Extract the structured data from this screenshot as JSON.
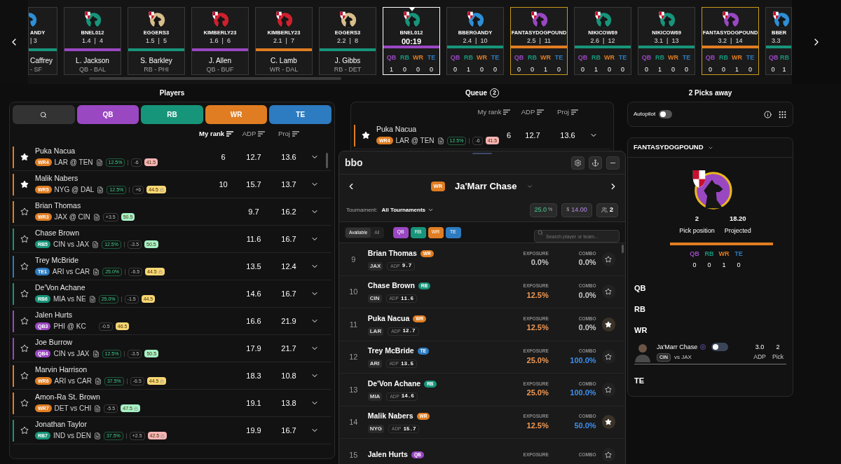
{
  "draft_board": {
    "picks": [
      {
        "kind": "pick",
        "team": "ANDY",
        "info": "| 3",
        "color": "#17957a",
        "avatar": {
          "color": "#2d8fd6"
        },
        "player": "Caffrey",
        "detail": "- SF",
        "selected": false,
        "mine": false
      },
      {
        "kind": "pick",
        "team": "BNEL012",
        "info": "1.4  |  4",
        "color": "#9a47c2",
        "avatar": {
          "color": "#16957c"
        },
        "player": "L. Jackson",
        "detail": "QB - BAL",
        "selected": false,
        "mine": false
      },
      {
        "kind": "pick",
        "team": "EGGERS3",
        "info": "1.5  |  5",
        "color": "#17957a",
        "avatar": {
          "color": "#d9be8c"
        },
        "player": "S. Barkley",
        "detail": "RB - PHI",
        "selected": false,
        "mine": false
      },
      {
        "kind": "pick",
        "team": "KIMBERLY23",
        "info": "1.6  |  6",
        "color": "#9a47c2",
        "avatar": {
          "color": "#d0202e"
        },
        "player": "J. Allen",
        "detail": "QB - BUF",
        "selected": false,
        "mine": false
      },
      {
        "kind": "pick",
        "team": "KIMBERLY23",
        "info": "2.1  |  7",
        "color": "#e07d22",
        "avatar": {
          "color": "#d0202e"
        },
        "player": "C. Lamb",
        "detail": "WR - DAL",
        "selected": false,
        "mine": false
      },
      {
        "kind": "pick",
        "team": "EGGERS3",
        "info": "2.2  |  8",
        "color": "#17957a",
        "avatar": {
          "color": "#d9be8c"
        },
        "player": "J. Gibbs",
        "detail": "RB - DET",
        "selected": false,
        "mine": false
      },
      {
        "kind": "upcoming",
        "team": "BNEL012",
        "timer": "00:19",
        "color": "#9a47c2",
        "avatar": {
          "color": "#16957c"
        },
        "selected": true,
        "mine": false,
        "counts": [
          {
            "label": "QB",
            "value": "1",
            "color": "#9a47c2"
          },
          {
            "label": "RB",
            "value": "0",
            "color": "#17957a"
          },
          {
            "label": "WR",
            "value": "0",
            "color": "#e07d22"
          },
          {
            "label": "TE",
            "value": "0",
            "color": "#2d7bc0"
          }
        ]
      },
      {
        "kind": "upcoming",
        "team": "BBERGANDY",
        "info": "2.4  |  10",
        "color": "#17957a",
        "avatar": {
          "color": "#2d8fd6"
        },
        "selected": false,
        "mine": false,
        "counts": [
          {
            "label": "QB",
            "value": "0",
            "color": "#9a47c2"
          },
          {
            "label": "RB",
            "value": "1",
            "color": "#17957a"
          },
          {
            "label": "WR",
            "value": "0",
            "color": "#e07d22"
          },
          {
            "label": "TE",
            "value": "0",
            "color": "#2d7bc0"
          }
        ]
      },
      {
        "kind": "upcoming",
        "team": "FANTASYDOGPOUND",
        "info": "2.5  |  11",
        "color": "#e07d22",
        "avatar": {
          "color": "#9a47c2"
        },
        "selected": false,
        "mine": true,
        "counts": [
          {
            "label": "QB",
            "value": "0",
            "color": "#9a47c2"
          },
          {
            "label": "RB",
            "value": "0",
            "color": "#17957a"
          },
          {
            "label": "WR",
            "value": "1",
            "color": "#e07d22"
          },
          {
            "label": "TE",
            "value": "0",
            "color": "#2d7bc0"
          }
        ]
      },
      {
        "kind": "upcoming",
        "team": "NIKICOW69",
        "info": "2.6  |  12",
        "color": "#17957a",
        "avatar": {
          "color": "#16957c"
        },
        "selected": false,
        "mine": false,
        "counts": [
          {
            "label": "QB",
            "value": "0",
            "color": "#9a47c2"
          },
          {
            "label": "RB",
            "value": "1",
            "color": "#17957a"
          },
          {
            "label": "WR",
            "value": "0",
            "color": "#e07d22"
          },
          {
            "label": "TE",
            "value": "0",
            "color": "#2d7bc0"
          }
        ]
      },
      {
        "kind": "upcoming",
        "team": "NIKICOW69",
        "info": "3.1  |  13",
        "color": "#17957a",
        "avatar": {
          "color": "#16957c"
        },
        "selected": false,
        "mine": false,
        "counts": [
          {
            "label": "QB",
            "value": "0",
            "color": "#9a47c2"
          },
          {
            "label": "RB",
            "value": "1",
            "color": "#17957a"
          },
          {
            "label": "WR",
            "value": "0",
            "color": "#e07d22"
          },
          {
            "label": "TE",
            "value": "0",
            "color": "#2d7bc0"
          }
        ]
      },
      {
        "kind": "upcoming",
        "team": "FANTASYDOGPOUND",
        "info": "3.2  |  14",
        "color": "#e07d22",
        "avatar": {
          "color": "#9a47c2"
        },
        "selected": false,
        "mine": true,
        "counts": [
          {
            "label": "QB",
            "value": "0",
            "color": "#9a47c2"
          },
          {
            "label": "RB",
            "value": "0",
            "color": "#17957a"
          },
          {
            "label": "WR",
            "value": "1",
            "color": "#e07d22"
          },
          {
            "label": "TE",
            "value": "0",
            "color": "#2d7bc0"
          }
        ]
      },
      {
        "kind": "upcoming",
        "team": "BBER",
        "info": "3.3",
        "color": "#17957a",
        "avatar": {
          "color": "#2d8fd6"
        },
        "selected": false,
        "mine": false,
        "counts": [
          {
            "label": "QB",
            "value": "0",
            "color": "#9a47c2"
          },
          {
            "label": "RB",
            "value": "1",
            "color": "#17957a"
          }
        ]
      }
    ]
  },
  "players": {
    "title": "Players",
    "filters": [
      {
        "kind": "search",
        "color": "#333333"
      },
      {
        "kind": "position",
        "label": "QB",
        "color": "#9a47c2"
      },
      {
        "kind": "position",
        "label": "RB",
        "color": "#17957a"
      },
      {
        "kind": "position",
        "label": "WR",
        "color": "#e07d22"
      },
      {
        "kind": "position",
        "label": "TE",
        "color": "#2d7bc0"
      }
    ],
    "columns": [
      {
        "label": "My rank",
        "active": true
      },
      {
        "label": "ADP",
        "active": false
      },
      {
        "label": "Proj",
        "active": false
      }
    ],
    "rows": [
      {
        "name": "Puka Nacua",
        "pos": "WR4",
        "color": "#e07d22",
        "matchup": "LAR @ TEN",
        "note": true,
        "exposure": "12.5%",
        "spread": "-6",
        "total": {
          "text": "41.5",
          "color": "#f6b4b4",
          "locked": false
        },
        "starred": true,
        "rank": "6",
        "adp": "12.7",
        "proj": "13.6"
      },
      {
        "name": "Malik Nabers",
        "pos": "WR5",
        "color": "#e07d22",
        "matchup": "NYG @ DAL",
        "note": true,
        "exposure": "12.5%",
        "spread": "+6",
        "total": {
          "text": "44.5",
          "color": "#f7d774",
          "locked": true
        },
        "starred": true,
        "rank": "10",
        "adp": "15.7",
        "proj": "13.7"
      },
      {
        "name": "Brian Thomas",
        "pos": "WR3",
        "color": "#e07d22",
        "matchup": "JAX @ CIN",
        "note": true,
        "spread": "+3.5",
        "total": {
          "text": "50.5",
          "color": "#a6f0c6",
          "locked": false
        },
        "starred": false,
        "adp": "9.7",
        "proj": "16.2"
      },
      {
        "name": "Chase Brown",
        "pos": "RB5",
        "color": "#17957a",
        "matchup": "CIN vs JAX",
        "note": true,
        "exposure": "12.5%",
        "spread": "-3.5",
        "total": {
          "text": "50.5",
          "color": "#a6f0c6",
          "locked": false
        },
        "starred": false,
        "adp": "11.6",
        "proj": "16.7"
      },
      {
        "name": "Trey McBride",
        "pos": "TE1",
        "color": "#2d7bc0",
        "matchup": "ARI vs CAR",
        "note": true,
        "exposure": "25.0%",
        "spread": "-6.5",
        "total": {
          "text": "44.5",
          "color": "#f7d774",
          "locked": true
        },
        "starred": false,
        "adp": "13.5",
        "proj": "12.4"
      },
      {
        "name": "De'Von Achane",
        "pos": "RB6",
        "color": "#17957a",
        "matchup": "MIA vs NE",
        "note": true,
        "exposure": "25.0%",
        "spread": "-1.5",
        "total": {
          "text": "44.5",
          "color": "#f7d774",
          "locked": false
        },
        "starred": false,
        "adp": "14.6",
        "proj": "16.7"
      },
      {
        "name": "Jalen Hurts",
        "pos": "QB3",
        "color": "#9a47c2",
        "matchup": "PHI @ KC",
        "note": false,
        "spread": "-0.5",
        "total": {
          "text": "46.5",
          "color": "#f7d774",
          "locked": false
        },
        "starred": false,
        "adp": "16.6",
        "proj": "21.9"
      },
      {
        "name": "Joe Burrow",
        "pos": "QB4",
        "color": "#9a47c2",
        "matchup": "CIN vs JAX",
        "note": true,
        "exposure": "12.5%",
        "spread": "-3.5",
        "total": {
          "text": "50.5",
          "color": "#a6f0c6",
          "locked": false
        },
        "starred": false,
        "adp": "17.9",
        "proj": "21.7"
      },
      {
        "name": "Marvin Harrison",
        "pos": "WR6",
        "color": "#e07d22",
        "matchup": "ARI vs CAR",
        "note": true,
        "exposure": "37.5%",
        "spread": "-6.5",
        "total": {
          "text": "44.5",
          "color": "#f7d774",
          "locked": true
        },
        "starred": false,
        "adp": "18.3",
        "proj": "10.8"
      },
      {
        "name": "Amon-Ra St. Brown",
        "pos": "WR7",
        "color": "#e07d22",
        "matchup": "DET vs CHI",
        "note": true,
        "spread": "-5.5",
        "total": {
          "text": "47.5",
          "color": "#a6f0c6",
          "locked": true
        },
        "starred": false,
        "adp": "19.1",
        "proj": "13.8"
      },
      {
        "name": "Jonathan Taylor",
        "pos": "RB7",
        "color": "#17957a",
        "matchup": "IND vs DEN",
        "note": true,
        "exposure": "37.5%",
        "spread": "+2.5",
        "total": {
          "text": "42.5",
          "color": "#f6b4b4",
          "locked": true
        },
        "starred": false,
        "adp": "19.9",
        "proj": "16.7"
      }
    ]
  },
  "queue": {
    "title": "Queue",
    "count": "2",
    "columns": [
      {
        "label": "My rank",
        "active": false
      },
      {
        "label": "ADP",
        "active": false
      },
      {
        "label": "Proj",
        "active": false
      }
    ],
    "rows": [
      {
        "name": "Puka Nacua",
        "pos": "WR4",
        "color": "#e07d22",
        "matchup": "LAR @ TEN",
        "note": true,
        "exposure": "12.5%",
        "spread": "-6",
        "total": {
          "text": "41.5",
          "color": "#f6b4b4",
          "locked": false
        },
        "starred": true,
        "rank": "6",
        "adp": "12.7",
        "proj": "13.6"
      }
    ]
  },
  "overlay": {
    "logo": "bbo",
    "player": {
      "pos": "WR",
      "color": "#e07d22",
      "name": "Ja'Marr Chase"
    },
    "tournament_label": "Tournament:",
    "tournament": "All Tournaments",
    "stats": [
      {
        "kind": "exposure",
        "value": "25.0",
        "unit": "%"
      },
      {
        "kind": "cost",
        "unit": "$",
        "value": "14.00"
      },
      {
        "kind": "entries",
        "value": "2"
      }
    ],
    "views": [
      {
        "label": "Available",
        "selected": true
      },
      {
        "label": "All",
        "selected": false
      }
    ],
    "chips": [
      {
        "label": "QB",
        "color": "#9a47c2"
      },
      {
        "label": "RB",
        "color": "#17957a"
      },
      {
        "label": "WR",
        "color": "#e07d22"
      },
      {
        "label": "TE",
        "color": "#2d7bc0"
      }
    ],
    "search": {
      "placeholder": "Search player or team..."
    },
    "rows": [
      {
        "rank": "9",
        "name": "Brian Thomas",
        "pos": "WR",
        "color": "#e07d22",
        "team": "JAX",
        "adp_label": "ADP",
        "adp": "9.7",
        "exposure_label": "EXPOSURE",
        "exposure": {
          "text": "0.0%",
          "color": "#c8c8c8"
        },
        "combo_label": "COMBO",
        "combo": {
          "text": "0.0%",
          "color": "#c8c8c8"
        },
        "starred": false
      },
      {
        "rank": "10",
        "name": "Chase Brown",
        "pos": "RB",
        "color": "#17957a",
        "team": "CIN",
        "adp_label": "ADP",
        "adp": "11.6",
        "exposure_label": "EXPOSURE",
        "exposure": {
          "text": "12.5%",
          "color": "#f29a55"
        },
        "combo_label": "COMBO",
        "combo": {
          "text": "0.0%",
          "color": "#c8c8c8"
        },
        "starred": false
      },
      {
        "rank": "11",
        "name": "Puka Nacua",
        "pos": "WR",
        "color": "#e07d22",
        "team": "LAR",
        "adp_label": "ADP",
        "adp": "12.7",
        "exposure_label": "EXPOSURE",
        "exposure": {
          "text": "12.5%",
          "color": "#f29a55"
        },
        "combo_label": "COMBO",
        "combo": {
          "text": "0.0%",
          "color": "#c8c8c8"
        },
        "starred": true
      },
      {
        "rank": "12",
        "name": "Trey McBride",
        "pos": "TE",
        "color": "#2d7bc0",
        "team": "ARI",
        "adp_label": "ADP",
        "adp": "13.5",
        "exposure_label": "EXPOSURE",
        "exposure": {
          "text": "25.0%",
          "color": "#f29a55"
        },
        "combo_label": "COMBO",
        "combo": {
          "text": "100.0%",
          "color": "#3b8ff0"
        },
        "starred": false
      },
      {
        "rank": "13",
        "name": "De'Von Achane",
        "pos": "RB",
        "color": "#17957a",
        "team": "MIA",
        "adp_label": "ADP",
        "adp": "14.6",
        "exposure_label": "EXPOSURE",
        "exposure": {
          "text": "25.0%",
          "color": "#f29a55"
        },
        "combo_label": "COMBO",
        "combo": {
          "text": "100.0%",
          "color": "#3b8ff0"
        },
        "starred": false
      },
      {
        "rank": "14",
        "name": "Malik Nabers",
        "pos": "WR",
        "color": "#e07d22",
        "team": "NYG",
        "adp_label": "ADP",
        "adp": "15.7",
        "exposure_label": "EXPOSURE",
        "exposure": {
          "text": "12.5%",
          "color": "#f29a55"
        },
        "combo_label": "COMBO",
        "combo": {
          "text": "50.0%",
          "color": "#3b8ff0"
        },
        "starred": true
      },
      {
        "rank": "15",
        "name": "Jalen Hurts",
        "pos": "QB",
        "color": "#9a47c2",
        "exposure_label": "EXPOSURE",
        "combo_label": "COMBO",
        "starred": false
      }
    ]
  },
  "roster": {
    "title": "2 Picks away",
    "autopilot": {
      "label": "Autopilot",
      "on": false
    },
    "team": "FANTASYDOGPOUND",
    "avatar": {
      "color": "#9a47c2"
    },
    "stats": [
      {
        "value": "2",
        "label": "Pick position"
      },
      {
        "value": "18.20",
        "label": "Projected"
      }
    ],
    "progress": {
      "level": 1
    },
    "counts": [
      {
        "label": "QB",
        "value": "0",
        "color": "#9a47c2"
      },
      {
        "label": "RB",
        "value": "0",
        "color": "#17957a"
      },
      {
        "label": "WR",
        "value": "1",
        "color": "#e07d22"
      },
      {
        "label": "TE",
        "value": "0",
        "color": "#2d7bc0"
      }
    ],
    "sections": [
      {
        "label": "QB"
      },
      {
        "label": "RB"
      },
      {
        "label": "WR",
        "players": [
          {
            "name": "Ja'Marr Chase",
            "team": "CIN",
            "matchup": "vs JAX",
            "on": false,
            "adp": "3.0",
            "adp_label": "ADP",
            "pick": "2",
            "pick_label": "Pick"
          }
        ]
      },
      {
        "label": "TE"
      }
    ]
  }
}
